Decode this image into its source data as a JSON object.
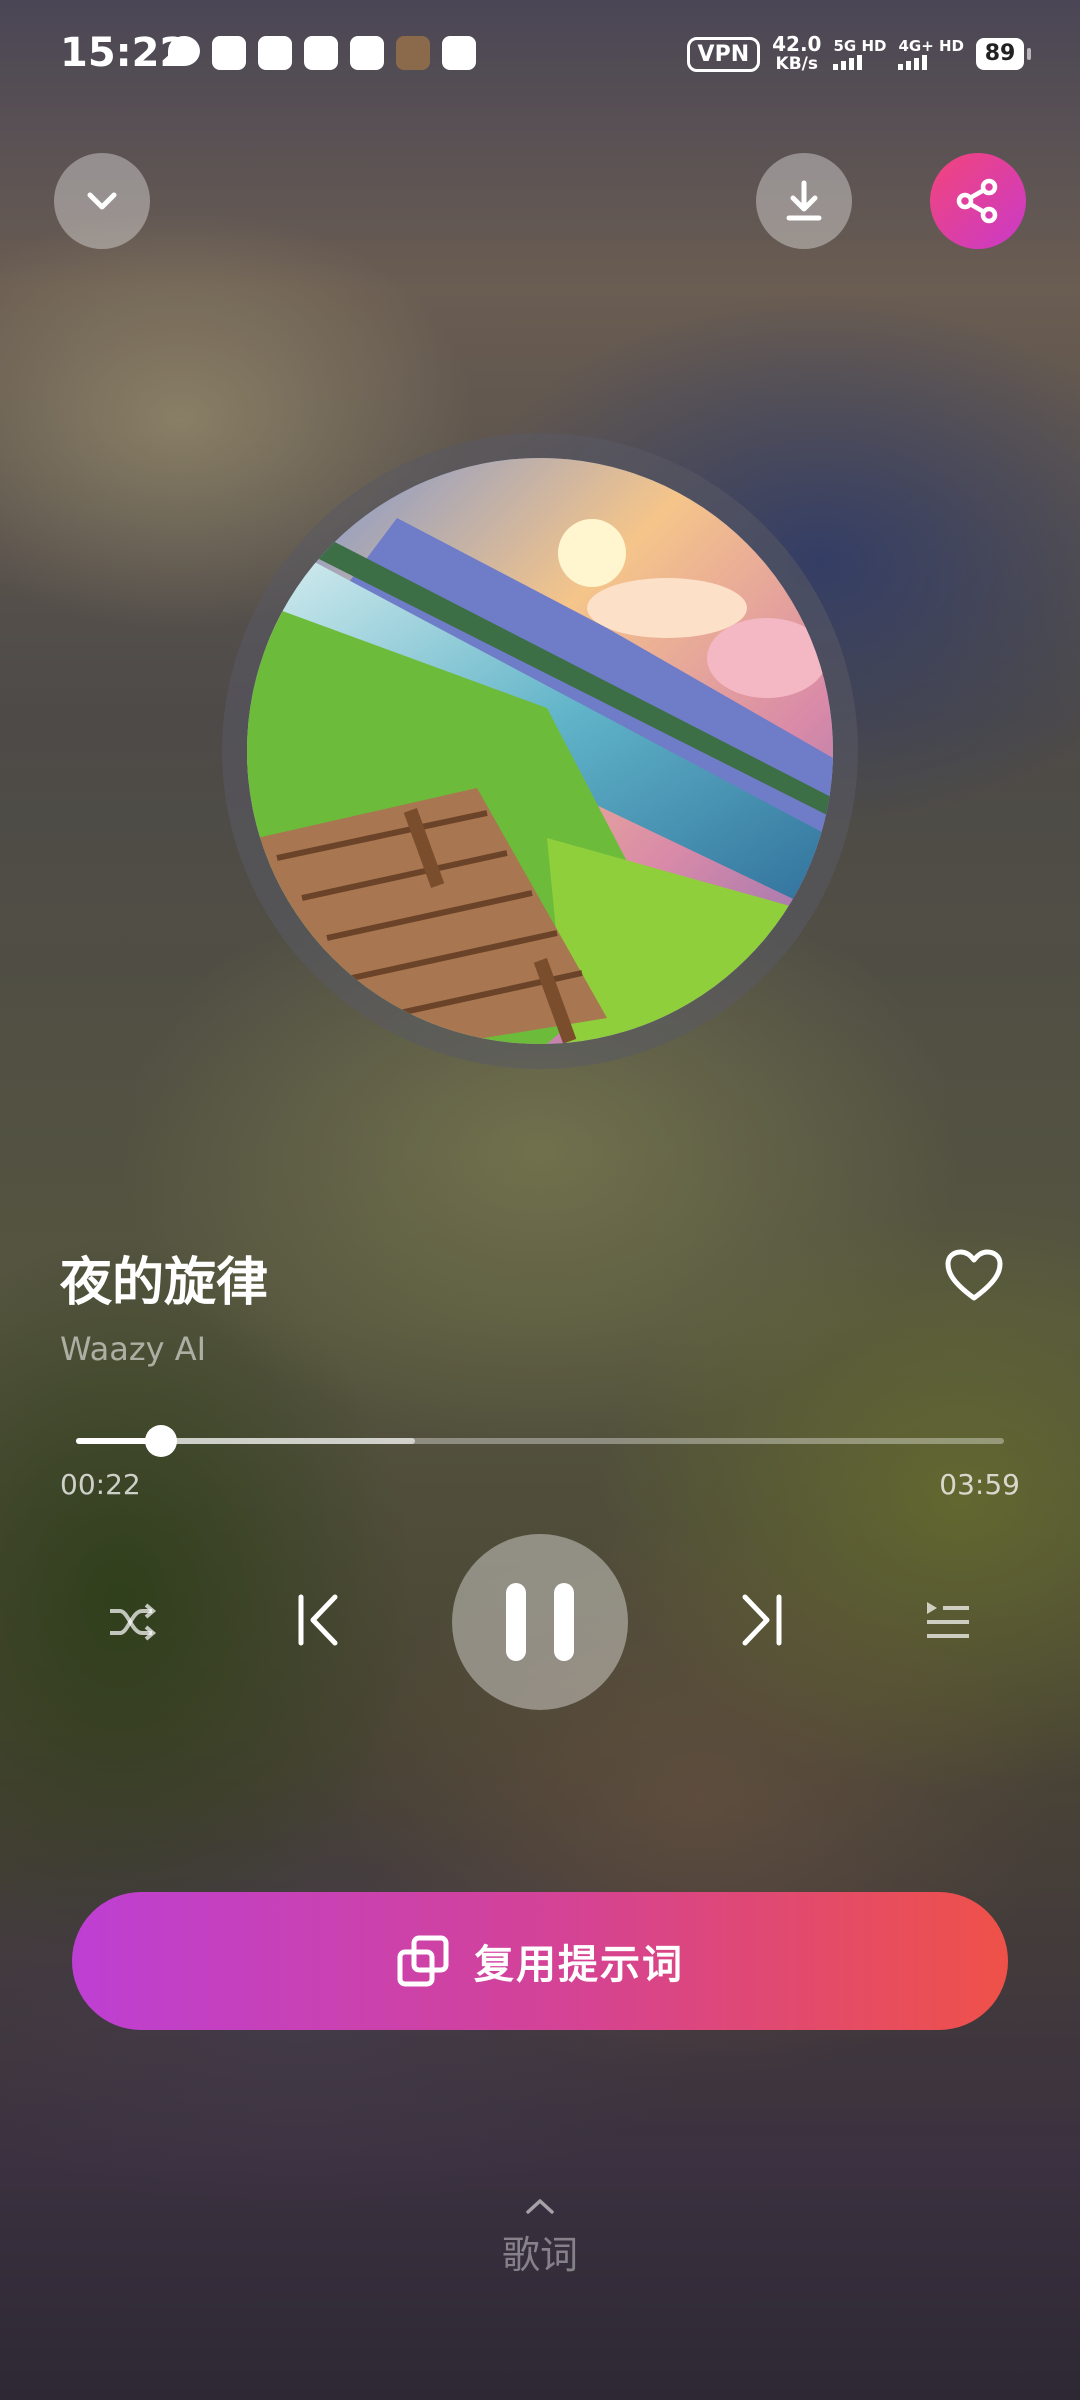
{
  "status_bar": {
    "time": "15:22",
    "vpn": "VPN",
    "net_speed": "42.0",
    "net_unit": "KB/s",
    "sim1": "5G HD",
    "sim2": "4G+ HD",
    "battery": "89"
  },
  "header": {
    "collapse_icon": "chevron-down-icon",
    "download_icon": "download-icon",
    "share_icon": "share-icon"
  },
  "song": {
    "title": "夜的旋律",
    "artist": "Waazy AI"
  },
  "progress": {
    "elapsed": "00:22",
    "total": "03:59",
    "played_fraction": 0.092,
    "buffered_fraction": 0.365
  },
  "controls": {
    "shuffle_icon": "shuffle-icon",
    "prev_icon": "previous-icon",
    "pause_icon": "pause-icon",
    "next_icon": "next-icon",
    "playlist_icon": "playlist-icon"
  },
  "reuse_button": {
    "label": "复用提示词",
    "icon": "copy-icon"
  },
  "lyrics": {
    "label": "歌词",
    "icon": "chevron-up-icon"
  },
  "colors": {
    "share_gradient": [
      "#f3457b",
      "#c93ac8"
    ],
    "reuse_gradient": [
      "#bd3fd3",
      "#d54392",
      "#ef5148"
    ]
  }
}
